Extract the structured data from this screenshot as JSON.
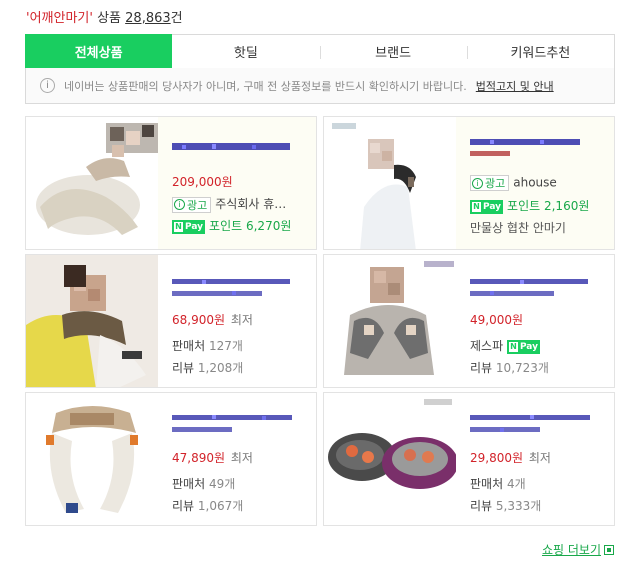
{
  "header": {
    "query": "'어깨안마기'",
    "product_label": "상품",
    "count": "28,863",
    "count_suffix": "건"
  },
  "tabs": [
    {
      "label": "전체상품",
      "active": true
    },
    {
      "label": "핫딜",
      "active": false
    },
    {
      "label": "브랜드",
      "active": false
    },
    {
      "label": "키워드추천",
      "active": false
    }
  ],
  "notice": {
    "text": "네이버는 상품판매의 당사자가 아니며, 구매 전 상품정보를 반드시 확인하시기 바랍니다.",
    "link": "법적고지 및 안내"
  },
  "products": [
    {
      "ad": true,
      "price": "209,000원",
      "ad_label": "광고",
      "seller": "주식회사 휴…",
      "npay": "Pay",
      "point_label": "포인트",
      "point": "6,270원",
      "extra": ""
    },
    {
      "ad": true,
      "price": "",
      "ad_label": "광고",
      "seller": "ahouse",
      "npay": "Pay",
      "point_label": "포인트",
      "point": "2,160원",
      "extra": "만물상 협찬 안마기"
    },
    {
      "ad": false,
      "price": "68,900원",
      "lowest": "최저",
      "seller_label": "판매처",
      "seller_count": "127개",
      "review_label": "리뷰",
      "review_count": "1,208개"
    },
    {
      "ad": false,
      "price": "49,000원",
      "lowest": "",
      "seller_text": "제스파",
      "npay": "Pay",
      "review_label": "리뷰",
      "review_count": "10,723개"
    },
    {
      "ad": false,
      "price": "47,890원",
      "lowest": "최저",
      "seller_label": "판매처",
      "seller_count": "49개",
      "review_label": "리뷰",
      "review_count": "1,067개"
    },
    {
      "ad": false,
      "price": "29,800원",
      "lowest": "최저",
      "seller_label": "판매처",
      "seller_count": "4개",
      "review_label": "리뷰",
      "review_count": "5,333개"
    }
  ],
  "footer": {
    "more_label": "쇼핑 더보기"
  },
  "colors": {
    "brand_green": "#19ce60",
    "price_red": "#d2232a"
  }
}
